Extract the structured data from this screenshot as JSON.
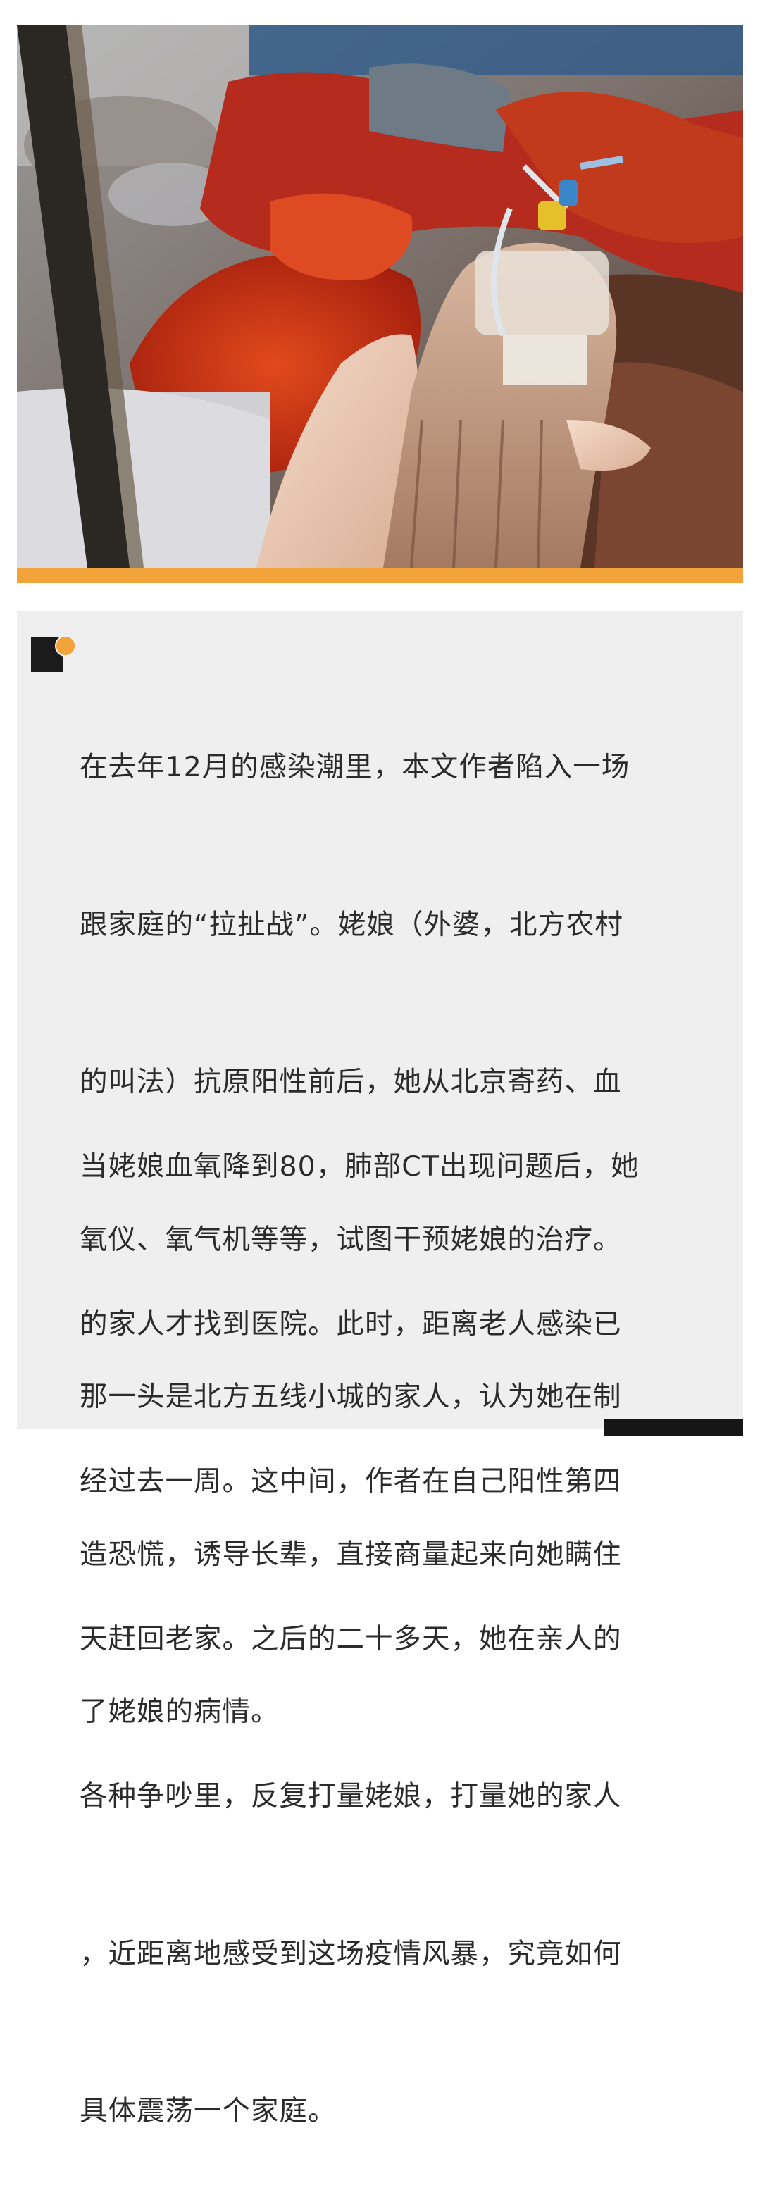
{
  "hero_image": {
    "description_icon": "photo-hands-iv-drip-icon",
    "accent_color": "#f2a33a"
  },
  "summary": {
    "background": "#efefef",
    "paragraph1_lines": [
      "在去年12月的感染潮里，本文作者陷入一场",
      "跟家庭的“拉扯战”。姥娘（外婆，北方农村",
      "的叫法）抗原阳性前后，她从北京寄药、血",
      "氧仪、氧气机等等，试图干预姥娘的治疗。",
      "那一头是北方五线小城的家人，认为她在制",
      "造恐慌，诱导长辈，直接商量起来向她瞒住",
      "了姥娘的病情。"
    ],
    "paragraph2_lines": [
      "当姥娘血氧降到80，肺部CT出现问题后，她",
      "的家人才找到医院。此时，距离老人感染已",
      "经过去一周。这中间，作者在自己阳性第四",
      "天赶回老家。之后的二十多天，她在亲人的",
      "各种争吵里，反复打量姥娘，打量她的家人",
      "，近距离地感受到这场疫情风暴，究竟如何",
      "具体震荡一个家庭。"
    ]
  }
}
